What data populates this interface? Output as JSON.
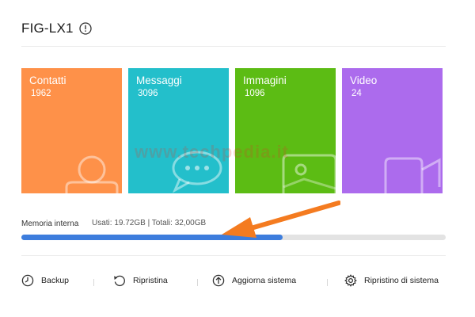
{
  "device": {
    "title": "FIG-LX1",
    "info_icon": "info-icon"
  },
  "tiles": [
    {
      "label": "Contatti",
      "count": "1962",
      "color": "#fe9149",
      "icon": "contacts-icon"
    },
    {
      "label": "Messaggi",
      "count": "3096",
      "color": "#23bfcb",
      "icon": "message-icon"
    },
    {
      "label": "Immagini",
      "count": "1096",
      "color": "#5cbc14",
      "icon": "image-icon"
    },
    {
      "label": "Video",
      "count": "24",
      "color": "#ac6bed",
      "icon": "video-icon"
    }
  ],
  "watermark": "www.techpedia.it",
  "storage": {
    "label": "Memoria interna",
    "usage": "Usati: 19.72GB | Totali: 32,00GB",
    "used_fraction": 0.616,
    "fill_color": "#3d7ddd",
    "track_color": "#e3e3e3"
  },
  "annotation": {
    "arrow_color": "#f47b20"
  },
  "actions": [
    {
      "label": "Backup",
      "icon": "backup-clock-icon"
    },
    {
      "label": "Ripristina",
      "icon": "restore-icon"
    },
    {
      "label": "Aggiorna sistema",
      "icon": "update-arrow-icon"
    },
    {
      "label": "Ripristino di sistema",
      "icon": "gear-icon"
    }
  ]
}
